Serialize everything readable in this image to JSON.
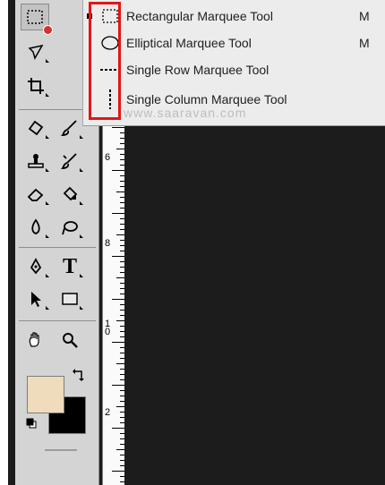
{
  "flyout_menu": {
    "items": [
      {
        "label": "Rectangular Marquee Tool",
        "shortcut": "M",
        "icon": "rectangular-marquee-icon",
        "selected": true
      },
      {
        "label": "Elliptical Marquee Tool",
        "shortcut": "M",
        "icon": "elliptical-marquee-icon",
        "selected": false
      },
      {
        "label": "Single Row Marquee Tool",
        "shortcut": "",
        "icon": "single-row-marquee-icon",
        "selected": false
      },
      {
        "label": "Single Column Marquee Tool",
        "shortcut": "",
        "icon": "single-column-marquee-icon",
        "selected": false
      }
    ]
  },
  "toolbar": {
    "tools": [
      "rectangular-marquee-icon",
      "lasso-icon",
      "crop-icon",
      "healing-brush-icon",
      "brush-icon",
      "clone-stamp-icon",
      "history-brush-icon",
      "eraser-icon",
      "paint-bucket-icon",
      "blur-icon",
      "dodge-icon",
      "pen-icon",
      "type-icon",
      "path-selection-icon",
      "rectangle-shape-icon",
      "hand-icon",
      "zoom-icon"
    ],
    "type_tool_glyph": "T"
  },
  "ruler": {
    "labels": [
      "6",
      "8",
      "10",
      "2"
    ]
  },
  "watermark": "www.saaravan.com",
  "colors": {
    "foreground": "#efdcbc",
    "background": "#000000",
    "highlight": "#e11616"
  }
}
